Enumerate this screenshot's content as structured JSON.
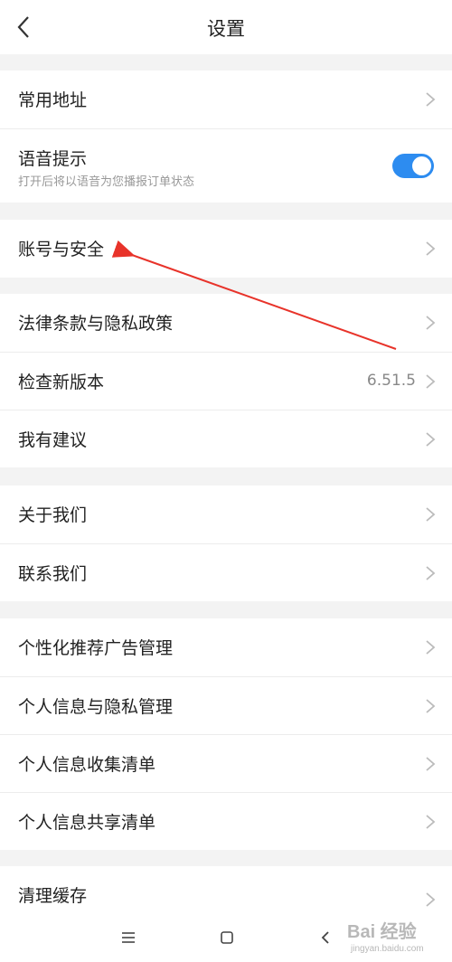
{
  "header": {
    "title": "设置"
  },
  "groups": {
    "g1": {
      "common_address": "常用地址",
      "voice_prompt": "语音提示",
      "voice_prompt_desc": "打开后将以语音为您播报订单状态",
      "voice_prompt_on": true
    },
    "g2": {
      "account_security": "账号与安全"
    },
    "g3": {
      "legal_privacy": "法律条款与隐私政策",
      "check_update": "检查新版本",
      "version": "6.51.5",
      "suggestions": "我有建议"
    },
    "g4": {
      "about_us": "关于我们",
      "contact_us": "联系我们"
    },
    "g5": {
      "personalized_ads": "个性化推荐广告管理",
      "personal_info_privacy": "个人信息与隐私管理",
      "personal_info_collection": "个人信息收集清单",
      "personal_info_sharing": "个人信息共享清单"
    },
    "g6": {
      "clear_cache": "清理缓存"
    }
  },
  "colors": {
    "toggle_on": "#2d8cf0",
    "annotation_arrow": "#e8332a"
  },
  "navbar": {
    "icons": [
      "menu-icon",
      "home-icon",
      "back-icon"
    ]
  },
  "watermark": {
    "main": "Bai 经验",
    "sub": "jingyan.baidu.com"
  }
}
